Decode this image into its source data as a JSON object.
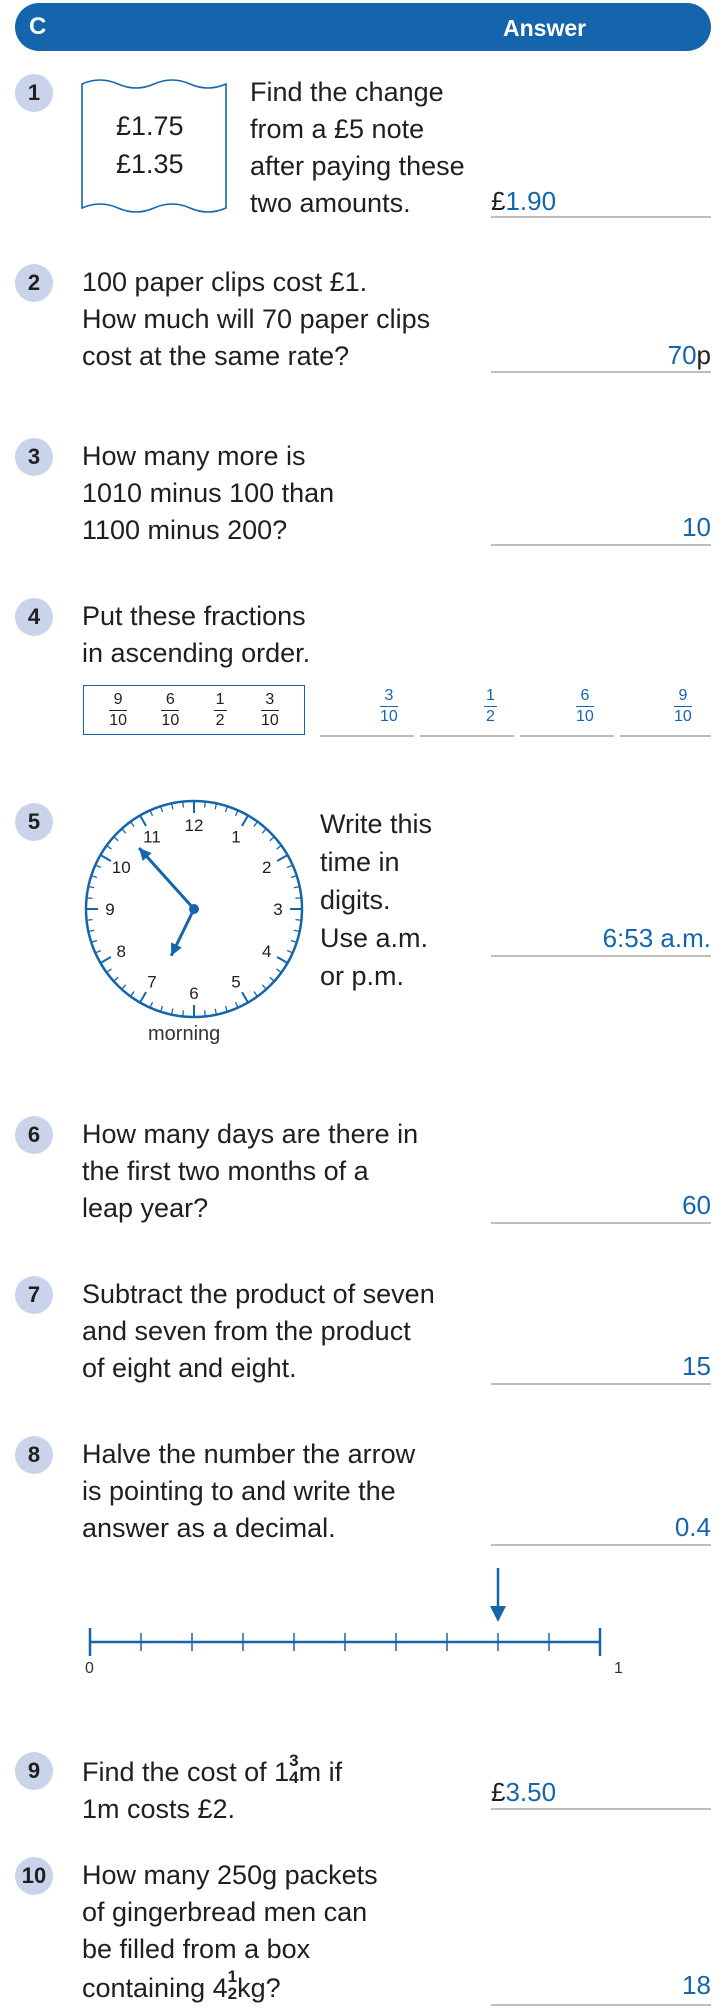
{
  "header": {
    "section": "C",
    "answer_label": "Answer"
  },
  "questions": [
    {
      "number": "1",
      "lines": [
        "Find the change",
        "from a £5 note",
        "after paying these",
        "two amounts."
      ],
      "receipt": [
        "£1.75",
        "£1.35"
      ],
      "answer_prefix": "£",
      "answer": "1.90"
    },
    {
      "number": "2",
      "lines": [
        "100 paper clips cost £1.",
        "How much will 70 paper clips",
        "cost at the same rate?"
      ],
      "answer": "70",
      "answer_suffix": "p"
    },
    {
      "number": "3",
      "lines": [
        "How many more is",
        "1010 minus 100 than",
        "1100 minus 200?"
      ],
      "answer": "10"
    },
    {
      "number": "4",
      "lines": [
        "Put these fractions",
        "in ascending order."
      ],
      "fractions": [
        {
          "n": "9",
          "d": "10"
        },
        {
          "n": "6",
          "d": "10"
        },
        {
          "n": "1",
          "d": "2"
        },
        {
          "n": "3",
          "d": "10"
        }
      ],
      "answer_fractions": [
        {
          "n": "3",
          "d": "10"
        },
        {
          "n": "1",
          "d": "2"
        },
        {
          "n": "6",
          "d": "10"
        },
        {
          "n": "9",
          "d": "10"
        }
      ]
    },
    {
      "number": "5",
      "lines": [
        "Write this",
        "time in",
        "digits.",
        "Use a.m.",
        "or p.m."
      ],
      "clock_numerals": [
        "12",
        "1",
        "2",
        "3",
        "4",
        "5",
        "6",
        "7",
        "8",
        "9",
        "10",
        "11"
      ],
      "clock_caption": "morning",
      "answer": "6:53 a.m."
    },
    {
      "number": "6",
      "lines": [
        "How many days are there in",
        "the first two months of a",
        "leap year?"
      ],
      "answer": "60"
    },
    {
      "number": "7",
      "lines": [
        "Subtract the product of seven",
        "and seven from the product",
        "of eight and eight."
      ],
      "answer": "15"
    },
    {
      "number": "8",
      "lines": [
        "Halve the number the arrow",
        "is pointing to and write the",
        "answer as a decimal."
      ],
      "numberline": {
        "start_label": "0",
        "end_label": "1",
        "divisions": 10,
        "arrow_at": 0.8
      },
      "answer": "0.4"
    },
    {
      "number": "9",
      "line1_pre": "Find the cost of 1",
      "frac": {
        "n": "3",
        "d": "4"
      },
      "line1_post": "m if",
      "line2": "1m costs £2.",
      "answer_prefix": "£",
      "answer": "3.50"
    },
    {
      "number": "10",
      "lines": [
        "How many 250g packets",
        "of gingerbread men can",
        "be filled from a box"
      ],
      "line4_pre": "containing 4",
      "frac": {
        "n": "1",
        "d": "2"
      },
      "line4_post": "kg?",
      "answer": "18"
    }
  ],
  "colors": {
    "accent": "#1565ad",
    "badge": "#c9d3ea"
  }
}
